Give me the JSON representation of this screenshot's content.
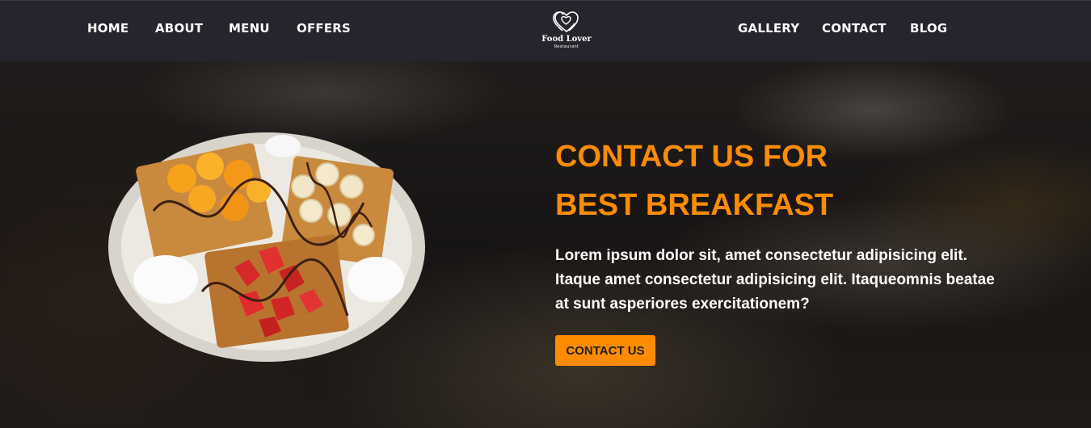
{
  "nav": {
    "left": [
      {
        "label": "HOME"
      },
      {
        "label": "ABOUT"
      },
      {
        "label": "MENU"
      },
      {
        "label": "OFFERS"
      }
    ],
    "right": [
      {
        "label": "GALLERY"
      },
      {
        "label": "CONTACT"
      },
      {
        "label": "BLOG"
      }
    ]
  },
  "logo": {
    "name": "Food Lover",
    "subtitle": "Restaurant",
    "icon": "heart-icon"
  },
  "hero": {
    "title_line1": "CONTACT US FOR",
    "title_line2": "BEST BREAKFAST",
    "text": "Lorem ipsum dolor sit, amet consectetur adipisicing elit. Itaque amet consectetur adipisicing elit. Itaqueomnis beatae at sunt asperiores exercitationem?",
    "cta_label": "CONTACT US"
  },
  "colors": {
    "accent": "#ff8c00",
    "navbar": "#26252d",
    "text": "#ffffff"
  }
}
